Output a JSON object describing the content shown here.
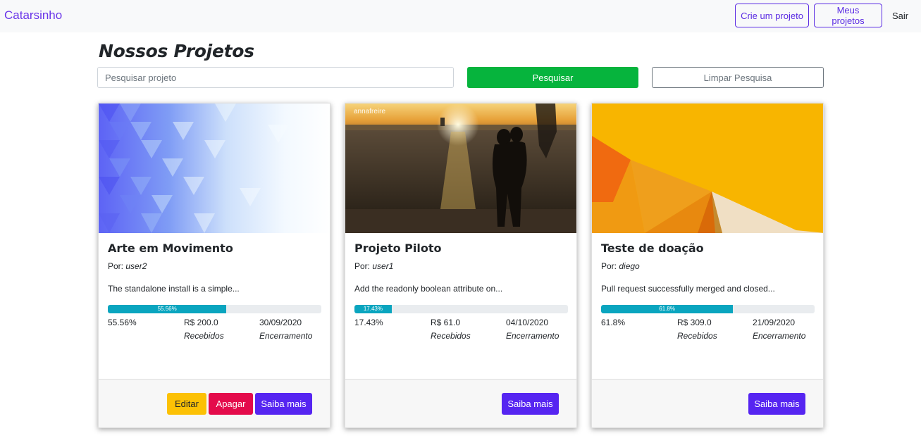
{
  "navbar": {
    "brand": "Catarsinho",
    "create_label": "Crie um projeto",
    "my_projects_label": "Meus projetos",
    "logout_label": "Sair"
  },
  "page": {
    "title": "Nossos Projetos"
  },
  "search": {
    "placeholder": "Pesquisar projeto",
    "value": "",
    "search_label": "Pesquisar",
    "clear_label": "Limpar Pesquisa"
  },
  "colors": {
    "brand": "#6a35e9",
    "search_button": "#06b43d",
    "progress": "#0aa5bf",
    "edit_button": "#fcc105",
    "delete_button": "#e40b4b",
    "more_button": "#5625f1"
  },
  "projects": [
    {
      "title": "Arte em Movimento",
      "author_label": "Por:",
      "author": "user2",
      "description": "The standalone install is a simple...",
      "progress": 55.56,
      "progress_label": "55.56%",
      "percent": "55.56%",
      "received": "R$ 200.0",
      "received_label": "Recebidos",
      "end_date": "30/09/2020",
      "end_label": "Encerramento",
      "edit_label": "Editar",
      "delete_label": "Apagar",
      "more_label": "Saiba mais",
      "image": "blue-triangle-mosaic"
    },
    {
      "title": "Projeto Piloto",
      "author_label": "Por:",
      "author": "user1",
      "description": "Add the readonly boolean attribute on...",
      "progress": 17.43,
      "progress_label": "17.43%",
      "percent": "17.43%",
      "received": "R$ 61.0",
      "received_label": "Recebidos",
      "end_date": "04/10/2020",
      "end_label": "Encerramento",
      "more_label": "Saiba mais",
      "image": "sunset-couple-beach",
      "image_watermark": "annafreire"
    },
    {
      "title": "Teste de doação",
      "author_label": "Por:",
      "author": "diego",
      "description": "Pull request successfully merged and closed...",
      "progress": 61.8,
      "progress_label": "61.8%",
      "percent": "61.8%",
      "received": "R$ 309.0",
      "received_label": "Recebidos",
      "end_date": "21/09/2020",
      "end_label": "Encerramento",
      "more_label": "Saiba mais",
      "image": "orange-geometric"
    }
  ]
}
